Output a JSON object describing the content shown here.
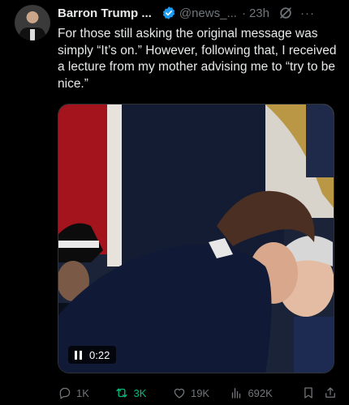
{
  "header": {
    "name": "Barron Trump ...",
    "handle": "@news_...",
    "separator": "·",
    "time": "23h",
    "more": "···"
  },
  "tweet": {
    "text": "For those still asking the original message was simply “It’s on.” However, following that, I received a lecture from my mother advising me to “try to be nice.”"
  },
  "video": {
    "timestamp": "0:22"
  },
  "actions": {
    "replies": "1K",
    "reposts": "3K",
    "likes": "19K",
    "views": "692K"
  },
  "colors": {
    "verified": "#1d9bf0",
    "repost_active": "#00ba7c",
    "muted": "#71767b"
  }
}
